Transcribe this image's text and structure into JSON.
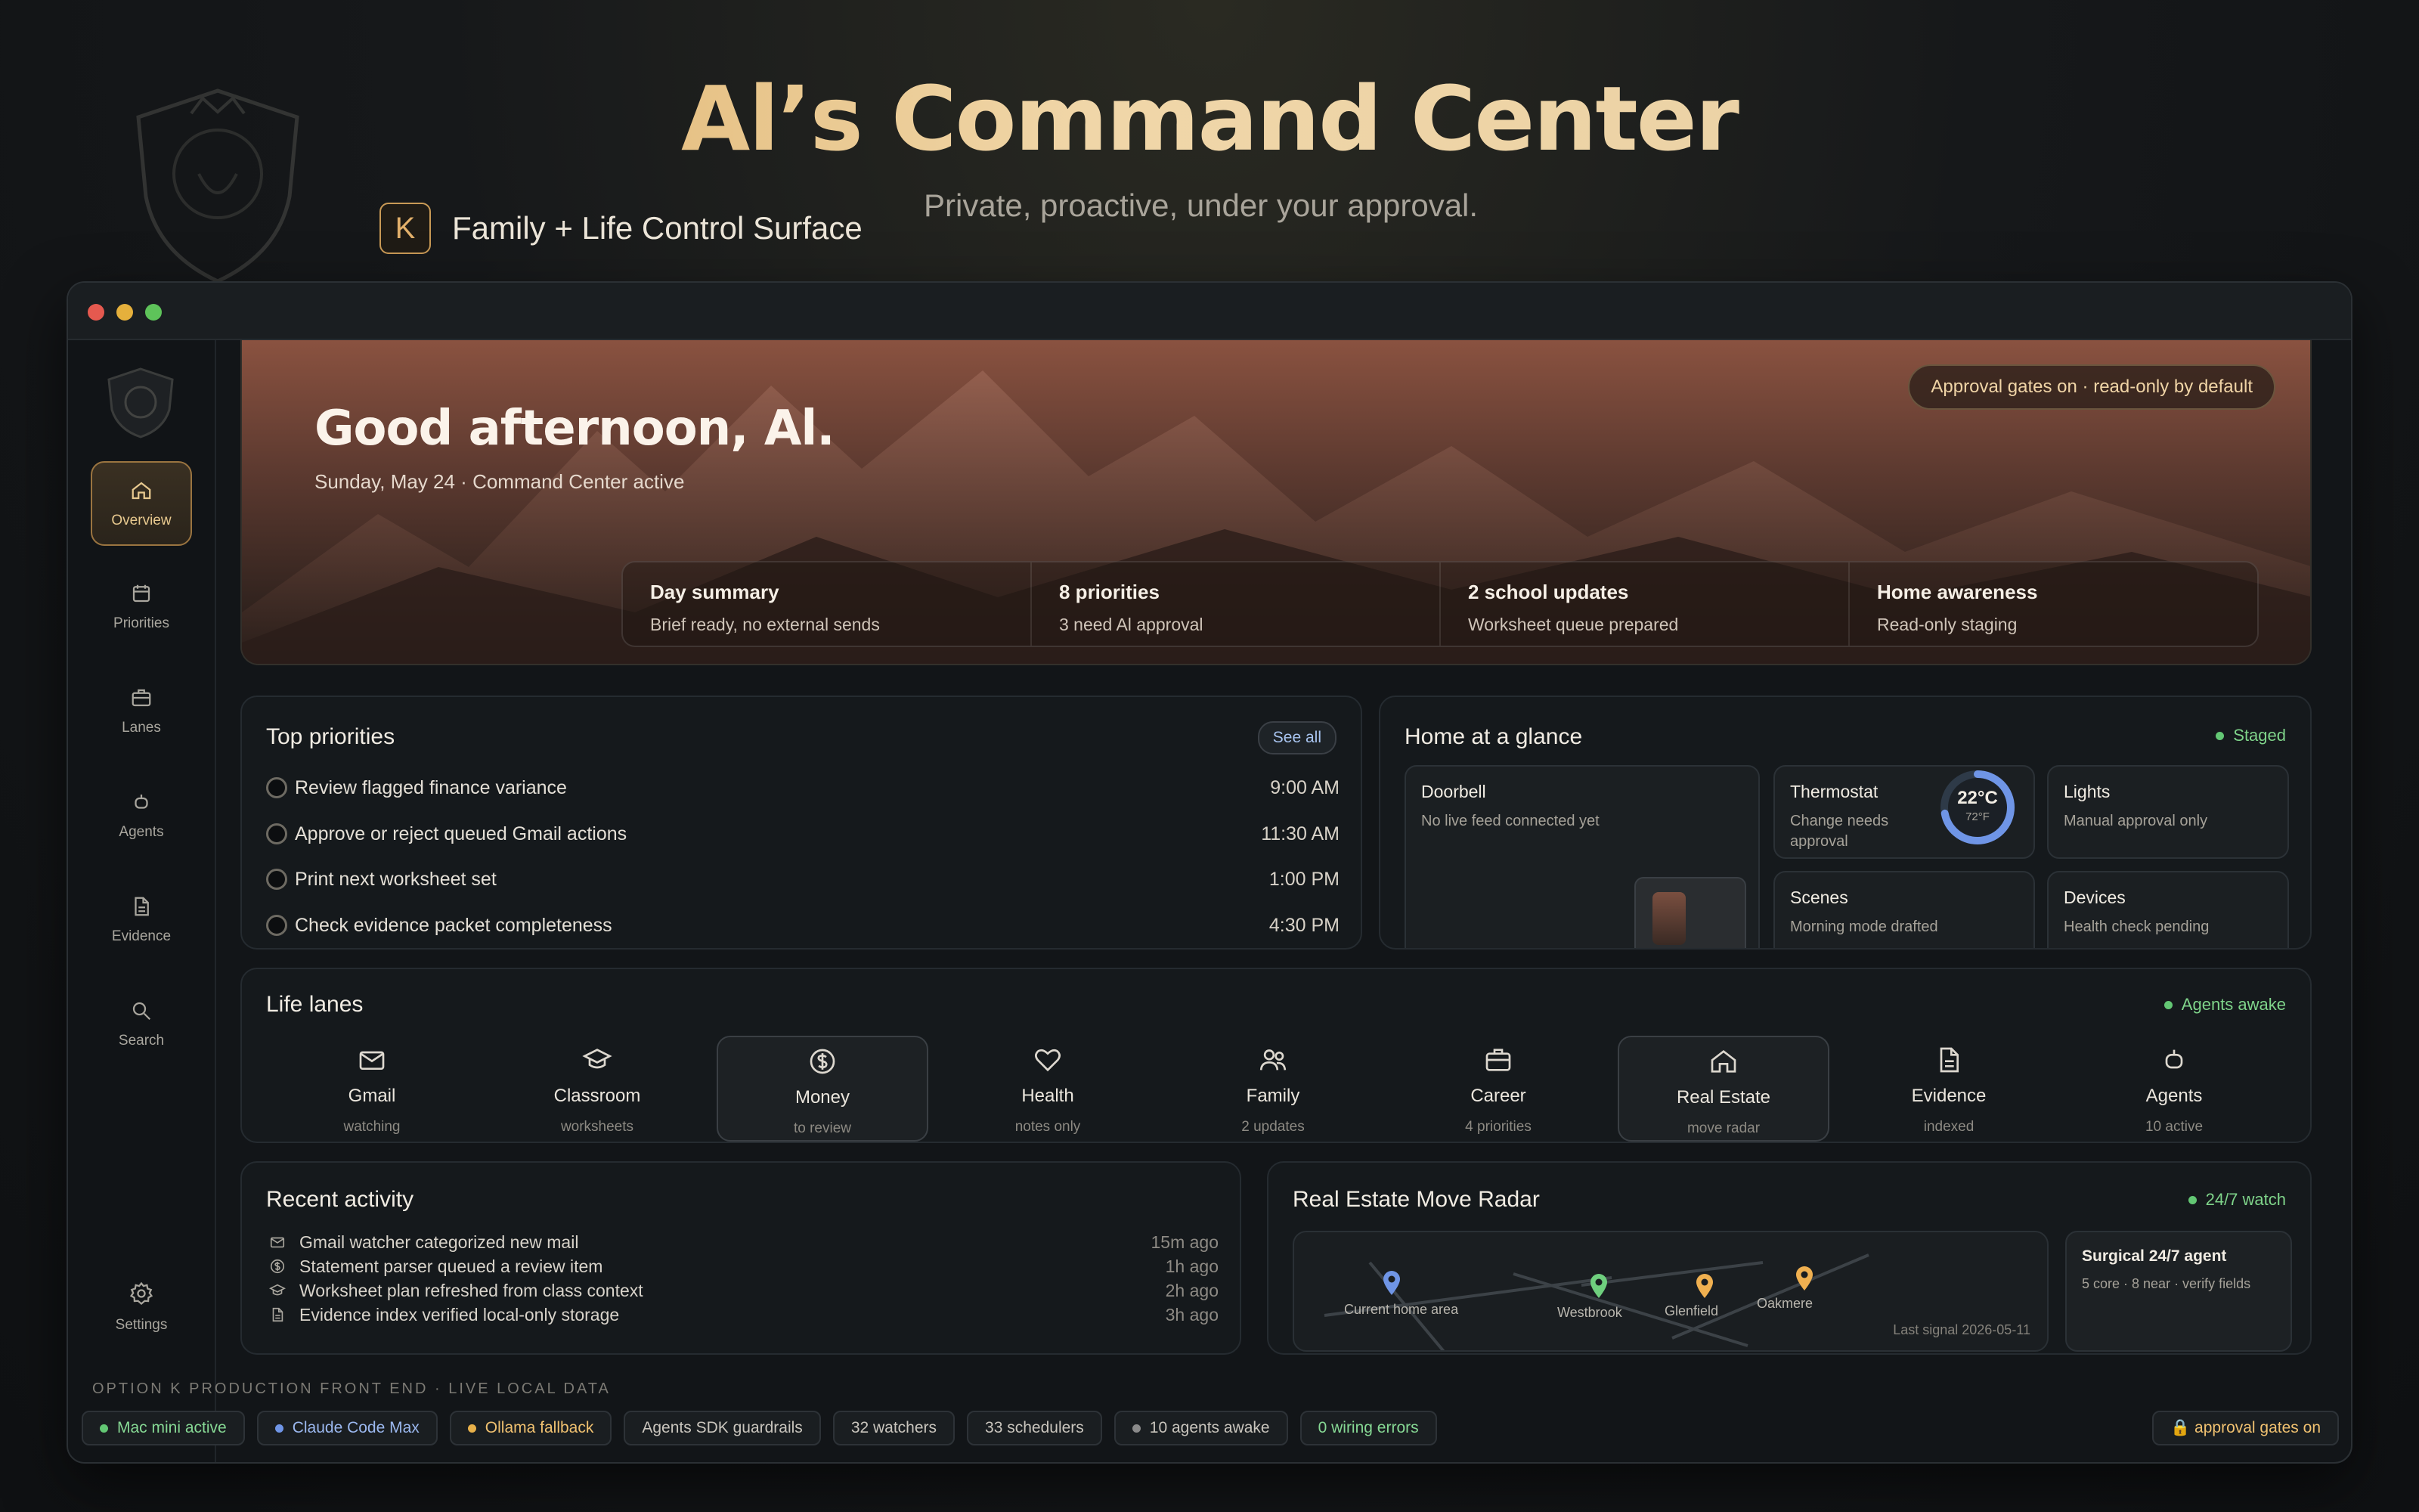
{
  "header": {
    "title": "Al’s Command Center",
    "subtitle": "Private, proactive, under your approval.",
    "brand_letter": "K",
    "brand_name": "Family + Life Control Surface"
  },
  "window": {
    "traffic_colors": [
      "#e5594f",
      "#e5b03c",
      "#5ec35a"
    ]
  },
  "sidebar": {
    "items": [
      {
        "label": "Overview",
        "icon": "home-icon",
        "active": true
      },
      {
        "label": "Priorities",
        "icon": "calendar-icon"
      },
      {
        "label": "Lanes",
        "icon": "briefcase-icon"
      },
      {
        "label": "Agents",
        "icon": "robot-icon"
      },
      {
        "label": "Evidence",
        "icon": "document-icon"
      },
      {
        "label": "Search",
        "icon": "search-icon"
      }
    ],
    "settings_label": "Settings"
  },
  "banner": {
    "greeting": "Good afternoon, Al.",
    "date_line": "Sunday, May 24 · Command Center active",
    "approval_pill": "Approval gates on · read-only by default",
    "stats": [
      {
        "title": "Day summary",
        "sub": "Brief ready, no external sends"
      },
      {
        "title": "8 priorities",
        "sub": "3 need Al approval"
      },
      {
        "title": "2 school updates",
        "sub": "Worksheet queue prepared"
      },
      {
        "title": "Home awareness",
        "sub": "Read-only staging"
      }
    ]
  },
  "priorities": {
    "title": "Top priorities",
    "see_all": "See all",
    "items": [
      {
        "label": "Review flagged finance variance",
        "time": "9:00 AM"
      },
      {
        "label": "Approve or reject queued Gmail actions",
        "time": "11:30 AM"
      },
      {
        "label": "Print next worksheet set",
        "time": "1:00 PM"
      },
      {
        "label": "Check evidence packet completeness",
        "time": "4:30 PM"
      }
    ]
  },
  "home": {
    "title": "Home at a glance",
    "status": "Staged",
    "doorbell": {
      "title": "Doorbell",
      "sub": "No live feed connected yet"
    },
    "thermostat": {
      "title": "Thermostat",
      "sub": "Change needs approval",
      "temp_c": "22°C",
      "temp_f": "72°F",
      "dial_fraction": 0.72
    },
    "lights": {
      "title": "Lights",
      "sub": "Manual approval only"
    },
    "scenes": {
      "title": "Scenes",
      "sub": "Morning mode drafted"
    },
    "devices": {
      "title": "Devices",
      "sub": "Health check pending"
    }
  },
  "lanes": {
    "title": "Life lanes",
    "status": "Agents awake",
    "items": [
      {
        "label": "Gmail",
        "sub": "watching",
        "icon": "mail-icon"
      },
      {
        "label": "Classroom",
        "sub": "worksheets",
        "icon": "graduation-cap-icon"
      },
      {
        "label": "Money",
        "sub": "to review",
        "icon": "dollar-icon",
        "highlight": true
      },
      {
        "label": "Health",
        "sub": "notes only",
        "icon": "heart-icon"
      },
      {
        "label": "Family",
        "sub": "2 updates",
        "icon": "people-icon"
      },
      {
        "label": "Career",
        "sub": "4 priorities",
        "icon": "briefcase-icon"
      },
      {
        "label": "Real Estate",
        "sub": "move radar",
        "icon": "house-icon",
        "highlight": true
      },
      {
        "label": "Evidence",
        "sub": "indexed",
        "icon": "document-icon"
      },
      {
        "label": "Agents",
        "sub": "10 active",
        "icon": "robot-icon"
      }
    ]
  },
  "activity": {
    "title": "Recent activity",
    "items": [
      {
        "label": "Gmail watcher categorized new mail",
        "ago": "15m ago",
        "icon": "mail-icon"
      },
      {
        "label": "Statement parser queued a review item",
        "ago": "1h ago",
        "icon": "dollar-icon"
      },
      {
        "label": "Worksheet plan refreshed from class context",
        "ago": "2h ago",
        "icon": "graduation-cap-icon"
      },
      {
        "label": "Evidence index verified local-only storage",
        "ago": "3h ago",
        "icon": "document-icon"
      }
    ]
  },
  "radar": {
    "title": "Real Estate Move Radar",
    "status": "24/7 watch",
    "pins": [
      {
        "label": "Current home area",
        "color": "#6f95e6"
      },
      {
        "label": "Westbrook",
        "color": "#6fcf7e"
      },
      {
        "label": "Glenfield",
        "color": "#f0b050"
      },
      {
        "label": "Oakmere",
        "color": "#f0b050"
      }
    ],
    "last_signal": "Last signal 2026-05-11",
    "agent_title": "Surgical 24/7 agent",
    "agent_sub": "5 core · 8 near · verify fields"
  },
  "footer": {
    "note": "OPTION K PRODUCTION FRONT END · LIVE LOCAL DATA",
    "chips": [
      {
        "label": "Mac mini active",
        "dot": "#63c774",
        "color": "#86d894"
      },
      {
        "label": "Claude Code Max",
        "dot": "#6f95e6",
        "color": "#9bb8ef"
      },
      {
        "label": "Ollama fallback",
        "dot": "#e8b14a",
        "color": "#f0c170"
      },
      {
        "label": "Agents SDK guardrails"
      },
      {
        "label": "32 watchers"
      },
      {
        "label": "33 schedulers"
      },
      {
        "label": "10 agents awake",
        "dot": "#8a8a8a"
      },
      {
        "label": "0 wiring errors",
        "color": "#86d894"
      }
    ],
    "right_chip": "🔒 approval gates on"
  }
}
